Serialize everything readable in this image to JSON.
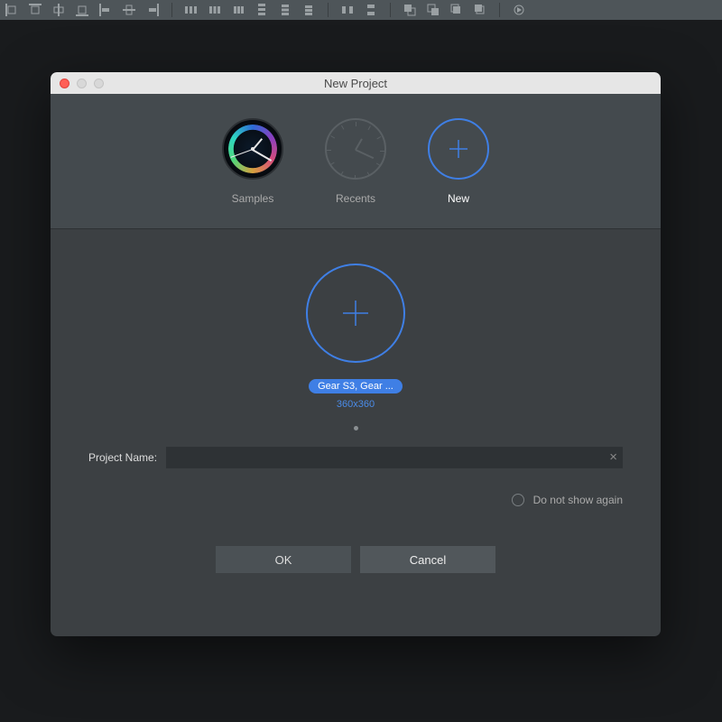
{
  "dialog": {
    "title": "New Project",
    "tabs": {
      "samples": "Samples",
      "recents": "Recents",
      "new": "New"
    },
    "device": {
      "name": "Gear S3, Gear ...",
      "resolution": "360x360"
    },
    "project_name_label": "Project Name:",
    "project_name_value": "",
    "do_not_show": "Do not show again",
    "ok": "OK",
    "cancel": "Cancel"
  }
}
